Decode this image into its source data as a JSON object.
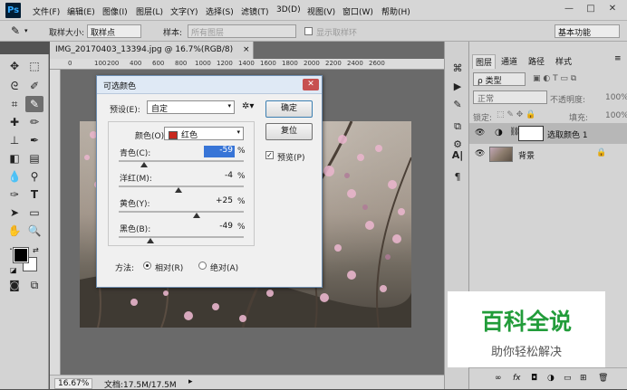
{
  "menubar": {
    "logo": "Ps",
    "items": [
      "文件(F)",
      "编辑(E)",
      "图像(I)",
      "图层(L)",
      "文字(Y)",
      "选择(S)",
      "滤镜(T)",
      "3D(D)",
      "视图(V)",
      "窗口(W)",
      "帮助(H)"
    ],
    "minimize": "—",
    "restore": "□",
    "close": "✕"
  },
  "options": {
    "sample_size_label": "取样大小:",
    "sample_size_value": "取样点",
    "sample_label": "样本:",
    "sample_value": "所有图层",
    "show_ring": "显示取样环",
    "workspace": "基本功能"
  },
  "document": {
    "tab_title": "IMG_20170403_13394.jpg @ 16.7%(RGB/8)",
    "tab_close": "×",
    "zoom": "16.67%",
    "status": "文档:17.5M/17.5M",
    "ruler_ticks": [
      "0",
      "100",
      "200",
      "400",
      "600",
      "800",
      "1000",
      "1200",
      "1400",
      "1600",
      "1800",
      "2000",
      "2200",
      "2400",
      "2600"
    ]
  },
  "dialog": {
    "title": "可选颜色",
    "preset_label": "预设(E):",
    "preset_value": "自定",
    "colors_label": "颜色(O):",
    "colors_value": "红色",
    "swatch_color": "#c8281e",
    "sliders": [
      {
        "label": "青色(C):",
        "value": "-59",
        "unit": "%",
        "level": -59
      },
      {
        "label": "洋红(M):",
        "value": "-4",
        "unit": "%",
        "level": -4
      },
      {
        "label": "黄色(Y):",
        "value": "+25",
        "unit": "%",
        "level": 25
      },
      {
        "label": "黑色(B):",
        "value": "-49",
        "unit": "%",
        "level": -49
      }
    ],
    "method_label": "方法:",
    "relative": "相对(R)",
    "absolute": "绝对(A)",
    "ok": "确定",
    "reset": "复位",
    "preview": "预览(P)"
  },
  "layers": {
    "tabs": [
      "图层",
      "通道",
      "路径",
      "样式"
    ],
    "kind": "ρ 类型",
    "blend_mode": "正常",
    "opacity_label": "不透明度:",
    "opacity": "100%",
    "lock_label": "锁定:",
    "fill_label": "填充:",
    "fill": "100%",
    "items": [
      {
        "name": "选取颜色 1"
      },
      {
        "name": "背景"
      }
    ]
  },
  "watermark": {
    "title": "百科全说",
    "subtitle": "助你轻松解决"
  }
}
